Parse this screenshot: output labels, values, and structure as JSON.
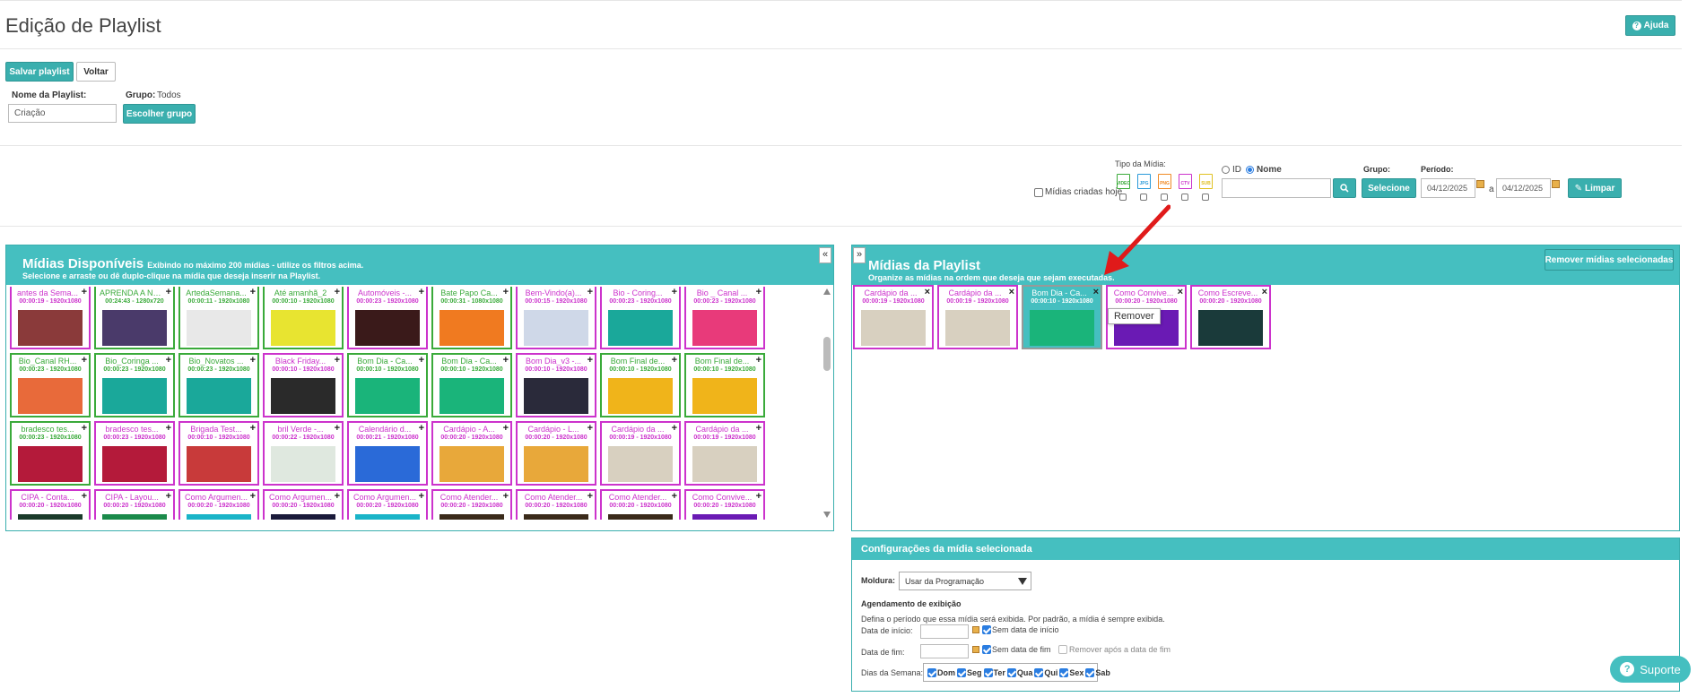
{
  "header": {
    "title": "Edição de Playlist",
    "help_label": "Ajuda"
  },
  "toolbar": {
    "save_label": "Salvar playlist",
    "back_label": "Voltar"
  },
  "form": {
    "name_label": "Nome da Playlist:",
    "name_value": "Criação",
    "group_label": "Grupo:",
    "group_value": "Todos",
    "choose_group_label": "Escolher grupo"
  },
  "filters": {
    "media_type_label": "Tipo da Mídia:",
    "types": [
      "VIDEO",
      "JPG",
      "PNG",
      "CTV",
      "SUB"
    ],
    "type_colors": [
      "#3aaa3a",
      "#2a9ad9",
      "#f08a24",
      "#cc33cc",
      "#e0c020"
    ],
    "created_today_label": "Mídias criadas hoje",
    "id_label": "ID",
    "name_label": "Nome",
    "search_value": "",
    "group_label": "Grupo:",
    "select_label": "Selecione",
    "period_label": "Período:",
    "date_from": "04/12/2025",
    "date_sep": "a",
    "date_to": "04/12/2025",
    "clear_label": "Limpar"
  },
  "available": {
    "title": "Mídias Disponíveis",
    "title_note": "Exibindo no máximo 200 mídias - utilize os filtros acima.",
    "subtitle": "Selecione e arraste ou dê duplo-clique na mídia que deseja inserir na Playlist.",
    "tiles": [
      {
        "name": "antes da Sema...",
        "info": "00:00:19 - 1920x1080",
        "color": "m",
        "thumb": "#8a3a3a"
      },
      {
        "name": "APRENDA A NÃ...",
        "info": "00:24:43 - 1280x720",
        "color": "g",
        "thumb": "#4a3a6a"
      },
      {
        "name": "ArtedaSemana...",
        "info": "00:00:11 - 1920x1080",
        "color": "g",
        "thumb": "#e8e8e8"
      },
      {
        "name": "Até amanhã_2",
        "info": "00:00:10 - 1920x1080",
        "color": "g",
        "thumb": "#e8e430"
      },
      {
        "name": "Automóveis -...",
        "info": "00:00:23 - 1920x1080",
        "color": "m",
        "thumb": "#3a1a1a"
      },
      {
        "name": "Bate Papo Ca...",
        "info": "00:00:31 - 1080x1080",
        "color": "g",
        "thumb": "#f07a20"
      },
      {
        "name": "Bem-Vindo(a)...",
        "info": "00:00:15 - 1920x1080",
        "color": "m",
        "thumb": "#cfd8e8"
      },
      {
        "name": "Bio - Coring...",
        "info": "00:00:23 - 1920x1080",
        "color": "m",
        "thumb": "#1aa89a"
      },
      {
        "name": "Bio _ Canal ...",
        "info": "00:00:23 - 1920x1080",
        "color": "m",
        "thumb": "#e83a7a"
      },
      {
        "name": "Bio_Canal RH...",
        "info": "00:00:23 - 1920x1080",
        "color": "g",
        "thumb": "#e86a3a"
      },
      {
        "name": "Bio_Coringa ...",
        "info": "00:00:23 - 1920x1080",
        "color": "g",
        "thumb": "#1aa89a"
      },
      {
        "name": "Bio_Novatos ...",
        "info": "00:00:23 - 1920x1080",
        "color": "g",
        "thumb": "#1aa89a"
      },
      {
        "name": "Black Friday...",
        "info": "00:00:10 - 1920x1080",
        "color": "m",
        "thumb": "#2a2a2a"
      },
      {
        "name": "Bom Dia - Ca...",
        "info": "00:00:10 - 1920x1080",
        "color": "g",
        "thumb": "#1ab47a"
      },
      {
        "name": "Bom Dia - Ca...",
        "info": "00:00:10 - 1920x1080",
        "color": "g",
        "thumb": "#1ab47a"
      },
      {
        "name": "Bom Dia_v3 -...",
        "info": "00:00:10 - 1920x1080",
        "color": "m",
        "thumb": "#2a2a3a"
      },
      {
        "name": "Bom Final de...",
        "info": "00:00:10 - 1920x1080",
        "color": "g",
        "thumb": "#f0b41a"
      },
      {
        "name": "Bom Final de...",
        "info": "00:00:10 - 1920x1080",
        "color": "g",
        "thumb": "#f0b41a"
      },
      {
        "name": "bradesco tes...",
        "info": "00:00:23 - 1920x1080",
        "color": "g",
        "thumb": "#b41a3a"
      },
      {
        "name": "bradesco tes...",
        "info": "00:00:23 - 1920x1080",
        "color": "m",
        "thumb": "#b41a3a"
      },
      {
        "name": "Brigada Test...",
        "info": "00:00:10 - 1920x1080",
        "color": "m",
        "thumb": "#c83a3a"
      },
      {
        "name": "bril Verde -...",
        "info": "00:00:22 - 1920x1080",
        "color": "m",
        "thumb": "#dfe8df"
      },
      {
        "name": "Calendário d...",
        "info": "00:00:21 - 1920x1080",
        "color": "m",
        "thumb": "#2a6ad8"
      },
      {
        "name": "Cardápio - A...",
        "info": "00:00:20 - 1920x1080",
        "color": "m",
        "thumb": "#e8a83a"
      },
      {
        "name": "Cardápio - L...",
        "info": "00:00:20 - 1920x1080",
        "color": "m",
        "thumb": "#e8a83a"
      },
      {
        "name": "Cardápio da ...",
        "info": "00:00:19 - 1920x1080",
        "color": "m",
        "thumb": "#d8d0c0"
      },
      {
        "name": "Cardápio da ...",
        "info": "00:00:19 - 1920x1080",
        "color": "m",
        "thumb": "#d8d0c0"
      },
      {
        "name": "CIPA - Conta...",
        "info": "00:00:20 - 1920x1080",
        "color": "m",
        "thumb": "#1a3a2a"
      },
      {
        "name": "CIPA - Layou...",
        "info": "00:00:20 - 1920x1080",
        "color": "m",
        "thumb": "#1a8a4a"
      },
      {
        "name": "Como Argumen...",
        "info": "00:00:20 - 1920x1080",
        "color": "m",
        "thumb": "#1ab4c8"
      },
      {
        "name": "Como Argumen...",
        "info": "00:00:20 - 1920x1080",
        "color": "m",
        "thumb": "#1a1a3a"
      },
      {
        "name": "Como Argumen...",
        "info": "00:00:20 - 1920x1080",
        "color": "m",
        "thumb": "#1ab4c8"
      },
      {
        "name": "Como Atender...",
        "info": "00:00:20 - 1920x1080",
        "color": "m",
        "thumb": "#3a2a1a"
      },
      {
        "name": "Como Atender...",
        "info": "00:00:20 - 1920x1080",
        "color": "m",
        "thumb": "#3a2a1a"
      },
      {
        "name": "Como Atender...",
        "info": "00:00:20 - 1920x1080",
        "color": "m",
        "thumb": "#3a2a1a"
      },
      {
        "name": "Como Convive...",
        "info": "00:00:20 - 1920x1080",
        "color": "m",
        "thumb": "#6a1ab4"
      }
    ]
  },
  "playlist": {
    "title": "Mídias da Playlist",
    "subtitle": "Organize as mídias na ordem que deseja que sejam executadas.",
    "remove_selected_label": "Remover mídias selecionadas",
    "tooltip": "Remover",
    "items": [
      {
        "name": "Cardápio da ...",
        "info": "00:00:19 - 1920x1080",
        "thumb": "#d8d0c0",
        "selected": false
      },
      {
        "name": "Cardápio da ...",
        "info": "00:00:19 - 1920x1080",
        "thumb": "#d8d0c0",
        "selected": false
      },
      {
        "name": "Bom Dia - Ca...",
        "info": "00:00:10 - 1920x1080",
        "thumb": "#1ab47a",
        "selected": true
      },
      {
        "name": "Como Convive...",
        "info": "00:00:20 - 1920x1080",
        "thumb": "#6a1ab4",
        "selected": false
      },
      {
        "name": "Como Escreve...",
        "info": "00:00:20 - 1920x1080",
        "thumb": "#1a3a3a",
        "selected": false
      }
    ]
  },
  "config": {
    "title": "Configurações da mídia selecionada",
    "frame_label": "Moldura:",
    "frame_value": "Usar da Programação",
    "schedule_title": "Agendamento de exibição",
    "schedule_desc": "Defina o período que essa mídia será exibida. Por padrão, a mídia é sempre exibida.",
    "start_label": "Data de início:",
    "no_start_label": "Sem data de início",
    "end_label": "Data de fim:",
    "no_end_label": "Sem data de fim",
    "remove_after_label": "Remover após a data de fim",
    "weekdays_label": "Dias da Semana:",
    "weekdays": [
      "Dom",
      "Seg",
      "Ter",
      "Qua",
      "Qui",
      "Sex",
      "Sab"
    ]
  },
  "support": {
    "label": "Suporte"
  },
  "colors": {
    "accent": "#3aafae",
    "header_bg": "#45bfc0",
    "magenta": "#cc33cc",
    "green": "#3aaa3a",
    "arrow": "#e01a1a"
  }
}
